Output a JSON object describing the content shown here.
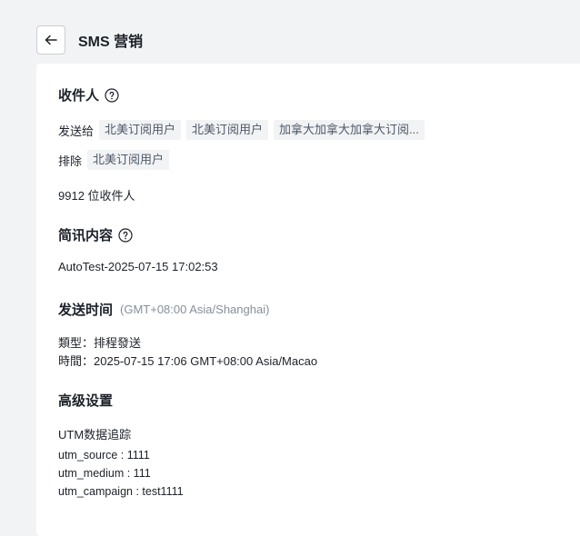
{
  "header": {
    "title": "SMS 营销"
  },
  "recipients": {
    "title": "收件人",
    "send_to_label": "发送给",
    "send_to_tags": [
      "北美订阅用户",
      "北美订阅用户",
      "加拿大加拿大加拿大订阅..."
    ],
    "exclude_label": "排除",
    "exclude_tags": [
      "北美订阅用户"
    ],
    "count_text": "9912 位收件人"
  },
  "content": {
    "title": "简讯内容",
    "value": "AutoTest-2025-07-15 17:02:53"
  },
  "send_time": {
    "title": "发送时间",
    "timezone": "(GMT+08:00 Asia/Shanghai)",
    "type_line": "類型：排程發送",
    "time_line": "時間：2025-07-15 17:06 GMT+08:00 Asia/Macao"
  },
  "advanced": {
    "title": "高级设置",
    "utm_title": "UTM数据追踪",
    "utm_source": "utm_source : 1111",
    "utm_medium": "utm_medium : 111",
    "utm_campaign": "utm_campaign : test1111"
  }
}
